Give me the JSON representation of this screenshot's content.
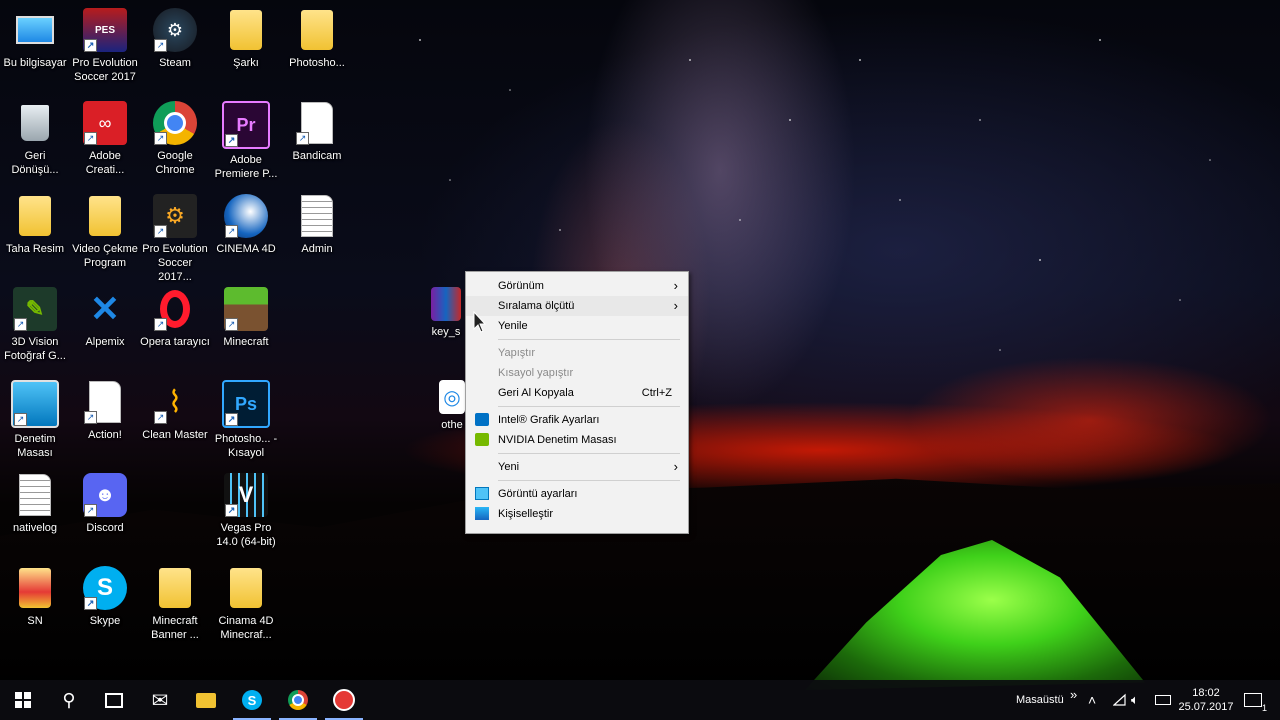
{
  "desktop": {
    "icons": [
      {
        "label": "Bu bilgisayar",
        "icon": "this-pc-icon"
      },
      {
        "label": "Pro Evolution Soccer 2017",
        "icon": "pes-icon"
      },
      {
        "label": "Steam",
        "icon": "steam-icon"
      },
      {
        "label": "Şarkı",
        "icon": "folder-icon"
      },
      {
        "label": "Photosho...",
        "icon": "folder-icon"
      },
      {
        "label": "Geri Dönüşü...",
        "icon": "recycle-bin-icon"
      },
      {
        "label": "Adobe Creati...",
        "icon": "adobe-cc-icon"
      },
      {
        "label": "Google Chrome",
        "icon": "chrome-icon"
      },
      {
        "label": "Adobe Premiere P...",
        "icon": "premiere-icon"
      },
      {
        "label": "Bandicam",
        "icon": "document-icon"
      },
      {
        "label": "Taha Resim",
        "icon": "folder-icon"
      },
      {
        "label": "Video Çekme Program",
        "icon": "folder-icon"
      },
      {
        "label": "Pro Evolution Soccer 2017...",
        "icon": "pes-settings-icon"
      },
      {
        "label": "CINEMA 4D",
        "icon": "cinema4d-icon"
      },
      {
        "label": "Admin",
        "icon": "text-file-icon"
      },
      {
        "label": "3D Vision Fotoğraf G...",
        "icon": "3d-vision-icon"
      },
      {
        "label": "Alpemix",
        "icon": "alpemix-icon"
      },
      {
        "label": "Opera tarayıcı",
        "icon": "opera-icon"
      },
      {
        "label": "Minecraft",
        "icon": "minecraft-icon"
      },
      {
        "label": "Denetim Masası",
        "icon": "control-panel-icon"
      },
      {
        "label": "Action!",
        "icon": "document-icon"
      },
      {
        "label": "Clean Master",
        "icon": "broom-icon"
      },
      {
        "label": "Photosho... - Kısayol",
        "icon": "photoshop-icon"
      },
      {
        "label": "nativelog",
        "icon": "text-file-icon"
      },
      {
        "label": "Discord",
        "icon": "discord-icon"
      },
      {
        "label": "Vegas Pro 14.0 (64-bit)",
        "icon": "vegas-icon"
      },
      {
        "label": "SN",
        "icon": "folder-icon"
      },
      {
        "label": "Skype",
        "icon": "skype-icon"
      },
      {
        "label": "Minecraft Banner ...",
        "icon": "folder-icon"
      },
      {
        "label": "Cinama 4D Minecraf...",
        "icon": "folder-icon"
      },
      {
        "label": "key_s",
        "icon": "winrar-icon"
      },
      {
        "label": "othe",
        "icon": "app-icon"
      }
    ]
  },
  "context_menu": {
    "items": {
      "view": "Görünüm",
      "sort_by": "Sıralama ölçütü",
      "refresh": "Yenile",
      "paste": "Yapıştır",
      "paste_shortcut": "Kısayol yapıştır",
      "undo_copy": "Geri Al Kopyala",
      "undo_shortcut": "Ctrl+Z",
      "intel_graphics": "Intel® Grafik Ayarları",
      "nvidia_panel": "NVIDIA Denetim Masası",
      "new": "Yeni",
      "display_settings": "Görüntü ayarları",
      "personalize": "Kişiselleştir"
    }
  },
  "taskbar": {
    "desktop_label": "Masaüstü",
    "overflow": "»",
    "time": "18:02",
    "date": "25.07.2017",
    "notification_count": "1"
  }
}
